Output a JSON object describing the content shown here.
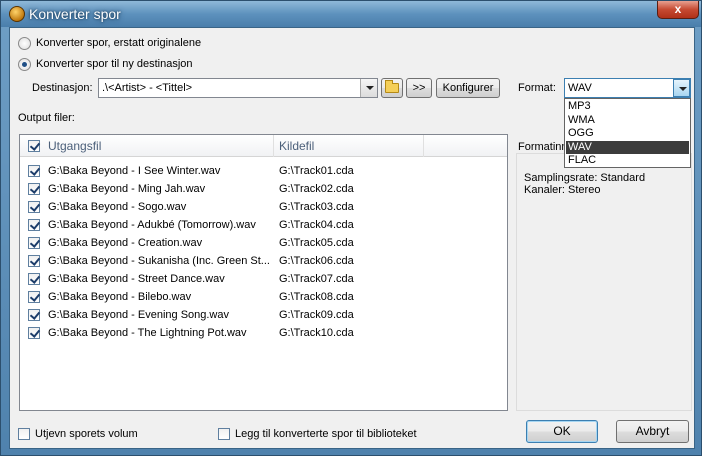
{
  "window": {
    "title": "Konverter spor",
    "close_glyph": "x"
  },
  "options": {
    "replace_label": "Konverter spor, erstatt originalene",
    "new_dest_label": "Konverter spor til ny destinasjon",
    "selected": "new_dest"
  },
  "destination": {
    "label": "Destinasjon:",
    "value": ".\\<Artist> - <Tittel>",
    "next_button": ">>",
    "configure_button": "Konfigurer"
  },
  "format": {
    "label": "Format:",
    "value": "WAV",
    "options": [
      "MP3",
      "WMA",
      "OGG",
      "WAV",
      "FLAC"
    ],
    "highlighted_index": 3
  },
  "output": {
    "label": "Output filer:",
    "columns": [
      "Utgangsfil",
      "Kildefil"
    ],
    "rows": [
      {
        "file": "G:\\Baka Beyond - I See Winter.wav",
        "src": "G:\\Track01.cda",
        "checked": true
      },
      {
        "file": "G:\\Baka Beyond - Ming Jah.wav",
        "src": "G:\\Track02.cda",
        "checked": true
      },
      {
        "file": "G:\\Baka Beyond - Sogo.wav",
        "src": "G:\\Track03.cda",
        "checked": true
      },
      {
        "file": "G:\\Baka Beyond - Adukbé (Tomorrow).wav",
        "src": "G:\\Track04.cda",
        "checked": true
      },
      {
        "file": "G:\\Baka Beyond - Creation.wav",
        "src": "G:\\Track05.cda",
        "checked": true
      },
      {
        "file": "G:\\Baka Beyond - Sukanisha (Inc. Green St...",
        "src": "G:\\Track06.cda",
        "checked": true
      },
      {
        "file": "G:\\Baka Beyond - Street Dance.wav",
        "src": "G:\\Track07.cda",
        "checked": true
      },
      {
        "file": "G:\\Baka Beyond - Bilebo.wav",
        "src": "G:\\Track08.cda",
        "checked": true
      },
      {
        "file": "G:\\Baka Beyond - Evening Song.wav",
        "src": "G:\\Track09.cda",
        "checked": true
      },
      {
        "file": "G:\\Baka Beyond - The Lightning Pot.wav",
        "src": "G:\\Track10.cda",
        "checked": true
      }
    ]
  },
  "info": {
    "heading": "Formatinn",
    "sample_rate": "Samplingsrate: Standard",
    "channels": "Kanaler: Stereo"
  },
  "footer": {
    "equalize_label": "Utjevn sporets volum",
    "add_library_label": "Legg til konverterte spor til biblioteket",
    "ok_button": "OK",
    "cancel_button": "Avbryt"
  },
  "colors": {
    "accent": "#3399ff",
    "titlebar": "#5d91bd"
  }
}
